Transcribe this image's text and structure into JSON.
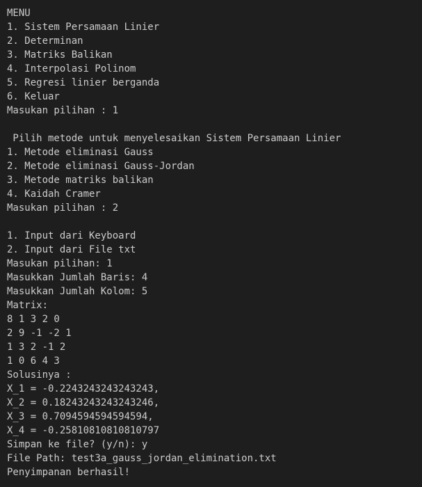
{
  "terminal": {
    "lines": [
      "MENU",
      "1. Sistem Persamaan Linier",
      "2. Determinan",
      "3. Matriks Balikan",
      "4. Interpolasi Polinom",
      "5. Regresi linier berganda",
      "6. Keluar",
      "Masukan pilihan : 1",
      "",
      " Pilih metode untuk menyelesaikan Sistem Persamaan Linier",
      "1. Metode eliminasi Gauss",
      "2. Metode eliminasi Gauss-Jordan",
      "3. Metode matriks balikan",
      "4. Kaidah Cramer",
      "Masukan pilihan : 2",
      "",
      "1. Input dari Keyboard",
      "2. Input dari File txt",
      "Masukan pilihan: 1",
      "Masukkan Jumlah Baris: 4",
      "Masukkan Jumlah Kolom: 5",
      "Matrix:",
      "8 1 3 2 0",
      "2 9 -1 -2 1",
      "1 3 2 -1 2",
      "1 0 6 4 3",
      "Solusinya :",
      "X_1 = -0.2243243243243243,",
      "X_2 = 0.18243243243243246,",
      "X_3 = 0.7094594594594594,",
      "X_4 = -0.25810810810810797",
      "Simpan ke file? (y/n): y",
      "File Path: test3a_gauss_jordan_elimination.txt",
      "Penyimpanan berhasil!"
    ]
  }
}
